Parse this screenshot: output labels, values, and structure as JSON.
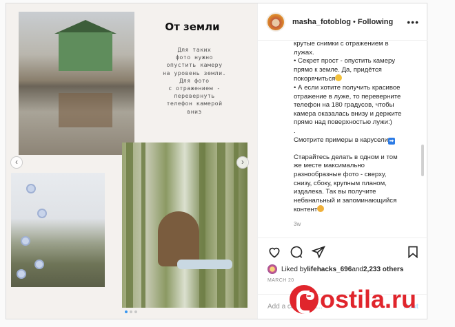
{
  "post": {
    "media": {
      "image_title": "От земли",
      "image_caption": "Для таких\nфото нужно\nопустить камеру\nна уровень земли.\nДля фото\nс отражением -\nперевернуть\nтелефон камерой\nвниз",
      "prev_arrow": "‹",
      "next_arrow": "›"
    },
    "header": {
      "username": "masha_fotoblog",
      "separator": " • ",
      "follow_status": "Following",
      "more_label": "•••"
    },
    "caption_lines": [
      "крутые снимки с отражением в",
      "лужах.",
      "• Секрет прост - опустить камеру",
      "прямо к земле. Да, придётся",
      "покорячиться",
      "• А если хотите получить красивое",
      "отражение в луже, то переверните",
      "телефон на 180 градусов, чтобы",
      "камера оказалась внизу и держите",
      "прямо над поверхностью лужи:)",
      ".",
      "Смотрите примеры в карусели",
      "Старайтесь делать в одном и том",
      "же месте максимально",
      "разнообразные фото - сверху,",
      "снизу, сбоку, крупным планом,",
      "издалека. Так вы получите",
      "небанальный и запоминающийся",
      "контент"
    ],
    "time_ago": "3w",
    "likes": {
      "prefix": "Liked by ",
      "user": "lifehacks_696",
      "middle": " and ",
      "others": "2,233 others"
    },
    "date": "MARCH 20",
    "add_comment_placeholder": "Add a comment…",
    "post_button": "Post",
    "icons": [
      "heart-icon",
      "comment-icon",
      "share-icon",
      "bookmark-icon"
    ],
    "accent_color": "#3897f0"
  },
  "watermark": {
    "text": "ostila.ru"
  }
}
